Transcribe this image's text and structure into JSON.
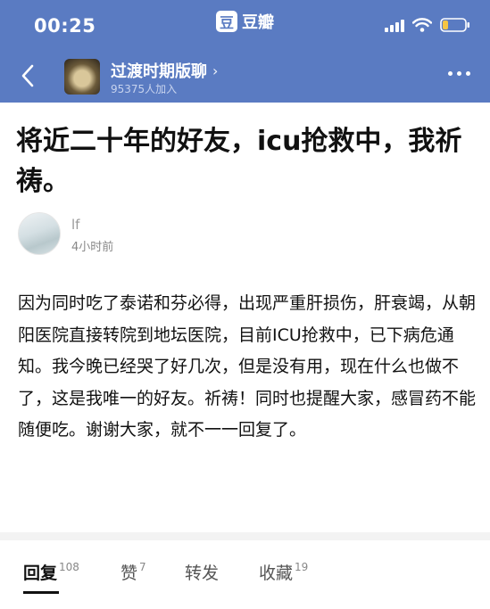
{
  "status_bar": {
    "time": "00:25",
    "app_badge_glyph": "豆",
    "app_name": "豆瓣",
    "icons": [
      "signal-icon",
      "wifi-icon",
      "battery-icon"
    ]
  },
  "nav": {
    "back_icon": "chevron-left-icon",
    "group_title": "过渡时期版聊",
    "group_chevron": "›",
    "group_members": "95375人加入",
    "more_icon": "more-dots-icon"
  },
  "post": {
    "title": "将近二十年的好友，icu抢救中，我祈祷。",
    "author": "lf",
    "time": "4小时前",
    "body": "因为同时吃了泰诺和芬必得，出现严重肝损伤，肝衰竭，从朝阳医院直接转院到地坛医院，目前ICU抢救中，已下病危通知。我今晚已经哭了好几次，但是没有用，现在什么也做不了，这是我唯一的好友。祈祷！同时也提醒大家，感冒药不能随便吃。谢谢大家，就不一一回复了。"
  },
  "tabs": [
    {
      "label": "回复",
      "count": "108"
    },
    {
      "label": "赞",
      "count": "7"
    },
    {
      "label": "转发",
      "count": ""
    },
    {
      "label": "收藏",
      "count": "19"
    }
  ],
  "colors": {
    "header_bg": "#5a7bc2",
    "text": "#111111",
    "muted": "#888888"
  }
}
